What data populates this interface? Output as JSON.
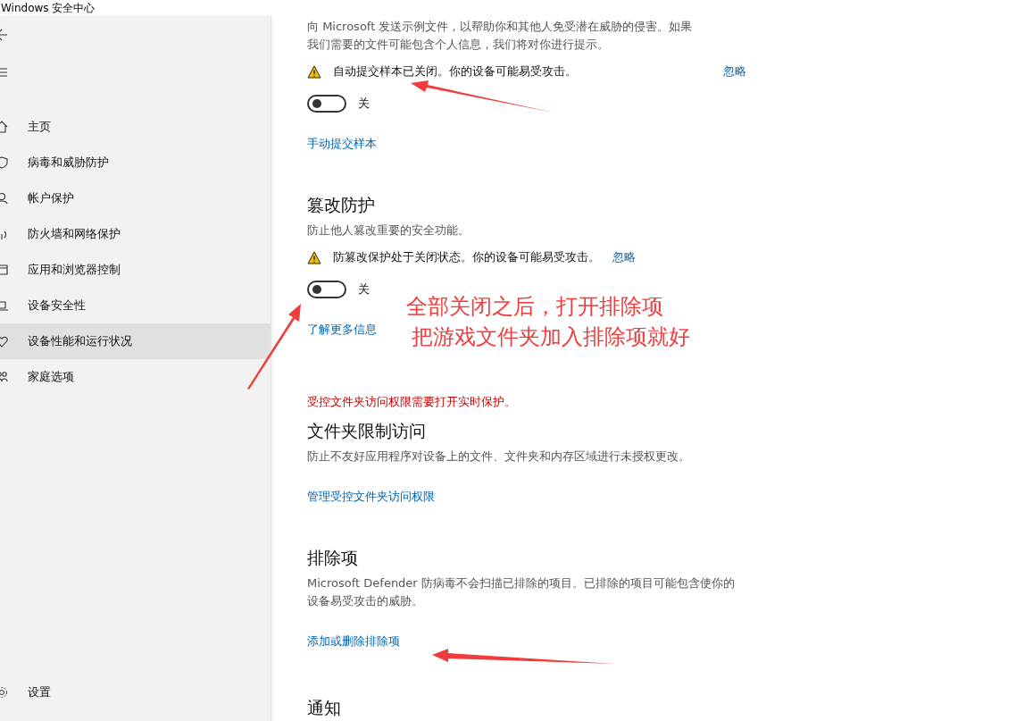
{
  "window": {
    "title": "Windows 安全中心"
  },
  "sidebar": {
    "items": [
      {
        "kind": "home",
        "label": "主页",
        "selected": false
      },
      {
        "kind": "shield",
        "label": "病毒和威胁防护",
        "selected": false
      },
      {
        "kind": "person",
        "label": "帐户保护",
        "selected": false
      },
      {
        "kind": "wifi",
        "label": "防火墙和网络保护",
        "selected": false
      },
      {
        "kind": "app",
        "label": "应用和浏览器控制",
        "selected": false
      },
      {
        "kind": "laptop",
        "label": "设备安全性",
        "selected": false
      },
      {
        "kind": "heart",
        "label": "设备性能和运行状况",
        "selected": true
      },
      {
        "kind": "family",
        "label": "家庭选项",
        "selected": false
      }
    ],
    "settings": {
      "label": "设置"
    }
  },
  "sections": [
    {
      "kind": "partial",
      "description": [
        "向 Microsoft 发送示例文件，以帮助你和其他人免受潜在威胁的侵害。如果",
        "我们需要的文件可能包含个人信息，我们将对你进行提示。"
      ],
      "warning": {
        "text": "自动提交样本已关闭。你的设备可能易受攻击。",
        "action": "忽略"
      },
      "toggle": {
        "on": false,
        "label": "关"
      },
      "link": "手动提交样本"
    },
    {
      "kind": "full",
      "title": "篡改防护",
      "description": [
        "防止他人篡改重要的安全功能。"
      ],
      "warning": {
        "text": "防篡改保护处于关闭状态。你的设备可能易受攻击。",
        "action": "忽略"
      },
      "toggle": {
        "on": false,
        "label": "关"
      },
      "link": "了解更多信息"
    },
    {
      "kind": "full",
      "error": "受控文件夹访问权限需要打开实时保护。",
      "title": "文件夹限制访问",
      "description": [
        "防止不友好应用程序对设备上的文件、文件夹和内存区域进行未授权更改。"
      ],
      "link": "管理受控文件夹访问权限"
    },
    {
      "kind": "full",
      "title": "排除项",
      "description": [
        "Microsoft Defender 防病毒不会扫描已排除的项目。已排除的项目可能包含使你的设备易受攻击的威胁。"
      ],
      "link": "添加或删除排除项"
    },
    {
      "kind": "full",
      "title": "通知"
    }
  ],
  "annotation": {
    "lines": [
      "全部关闭之后，打开排除项",
      "把游戏文件夹加入排除项就好"
    ]
  }
}
